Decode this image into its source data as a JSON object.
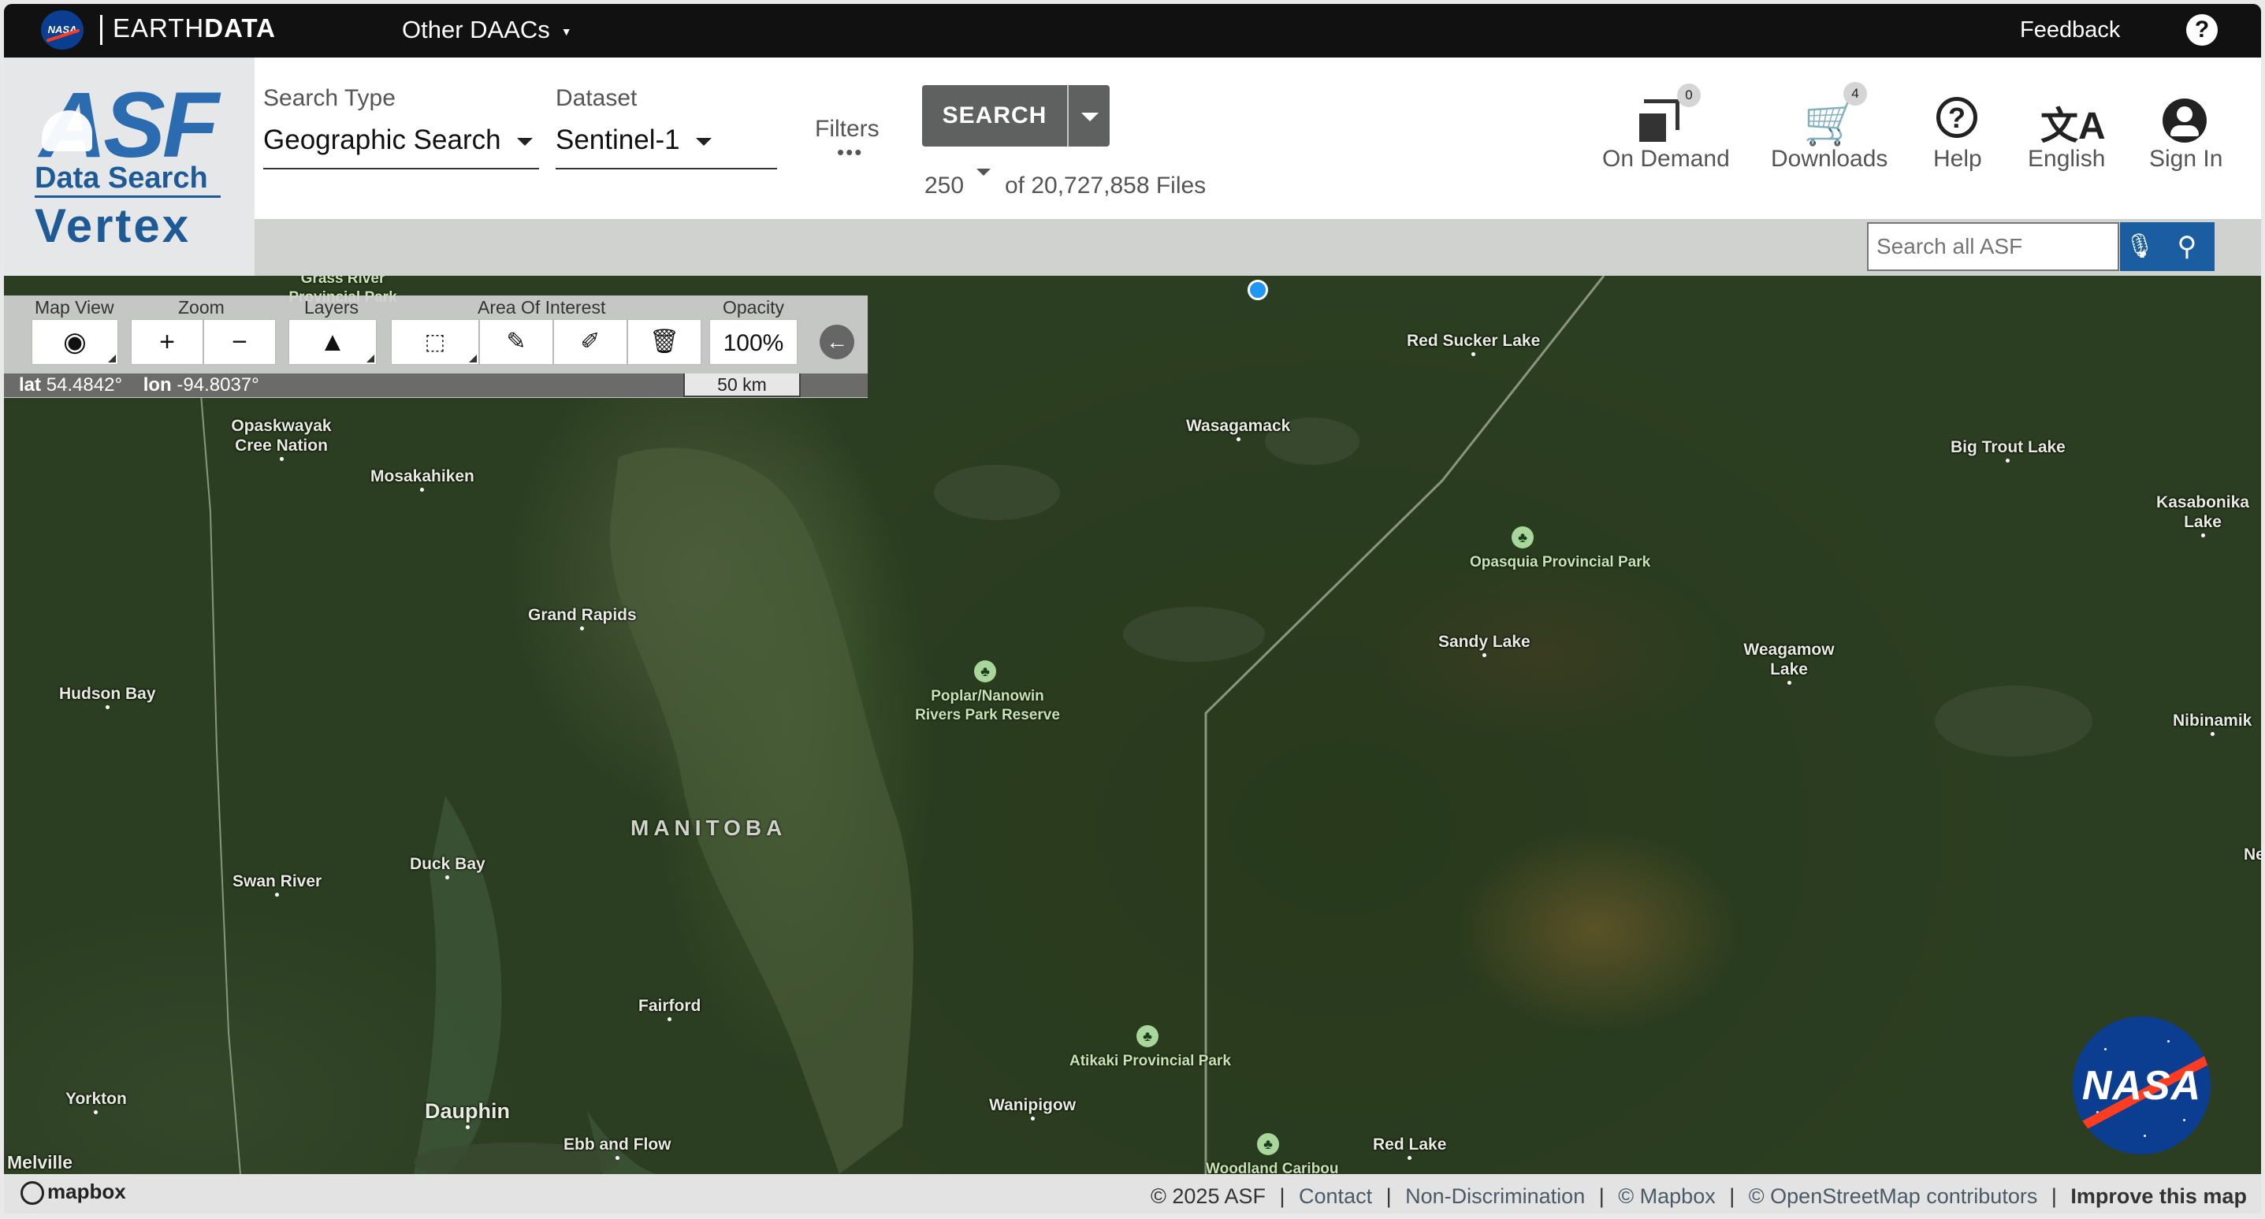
{
  "topbar": {
    "nasa_small": "NASA",
    "earthdata_light": "EARTH",
    "earthdata_bold": "DATA",
    "other_daacs": "Other DAACs",
    "feedback": "Feedback",
    "help": "?"
  },
  "logo": {
    "asf": "ASF",
    "data_search": "Data Search",
    "vertex": "Vertex"
  },
  "search": {
    "type_label": "Search Type",
    "type_value": "Geographic Search",
    "dataset_label": "Dataset",
    "dataset_value": "Sentinel-1",
    "filters": "Filters",
    "filters_dots": "•••",
    "button": "SEARCH",
    "max_results": "250",
    "file_count": "of 20,727,858 Files"
  },
  "header_icons": {
    "on_demand": {
      "label": "On Demand",
      "badge": "0"
    },
    "downloads": {
      "label": "Downloads",
      "badge": "4"
    },
    "help": {
      "label": "Help"
    },
    "language": {
      "label": "English",
      "glyph": "文A"
    },
    "sign_in": {
      "label": "Sign In"
    }
  },
  "asf_search": {
    "placeholder": "Search all ASF"
  },
  "map_tools": {
    "map_view": "Map View",
    "zoom": "Zoom",
    "layers": "Layers",
    "aoi": "Area Of Interest",
    "opacity": "Opacity",
    "opacity_value": "100%",
    "zoom_in": "+",
    "zoom_out": "−",
    "lat_label": "lat",
    "lat_value": "54.4842°",
    "lon_label": "lon",
    "lon_value": "-94.8037°",
    "scale": "50 km"
  },
  "map_labels": {
    "province": "MANITOBA",
    "places": [
      "Red Sucker Lake",
      "Wasagamack",
      "Big Trout Lake",
      "Kasabonika Lake",
      "Opaskwayak Cree Nation",
      "Mosakahiken",
      "Grand Rapids",
      "Sandy Lake",
      "Weagamow Lake",
      "Hudson Bay",
      "Nibinamik",
      "Swan River",
      "Duck Bay",
      "Fairford",
      "Yorkton",
      "Dauphin",
      "Ebb and Flow",
      "Wanipigow",
      "Red Lake",
      "Melville",
      "Ne"
    ],
    "parks": [
      "Opasquia Provincial Park",
      "Poplar/Nanowin Rivers Park Reserve",
      "Atikaki Provincial Park",
      "Woodland Caribou",
      "Grass River Provincial Park"
    ]
  },
  "nasa_big": "NASA",
  "footer": {
    "mapbox": "mapbox",
    "copyright": "© 2025 ASF",
    "contact": "Contact",
    "nondiscrimination": "Non-Discrimination",
    "mapbox_credit": "© Mapbox",
    "osm": "© OpenStreetMap contributors",
    "improve": "Improve this map"
  },
  "colors": {
    "accent": "#1a5da0",
    "topbar": "#111111",
    "search_button": "#5f6160",
    "nasa_blue": "#0b3d91",
    "nasa_red": "#fc3d21"
  }
}
